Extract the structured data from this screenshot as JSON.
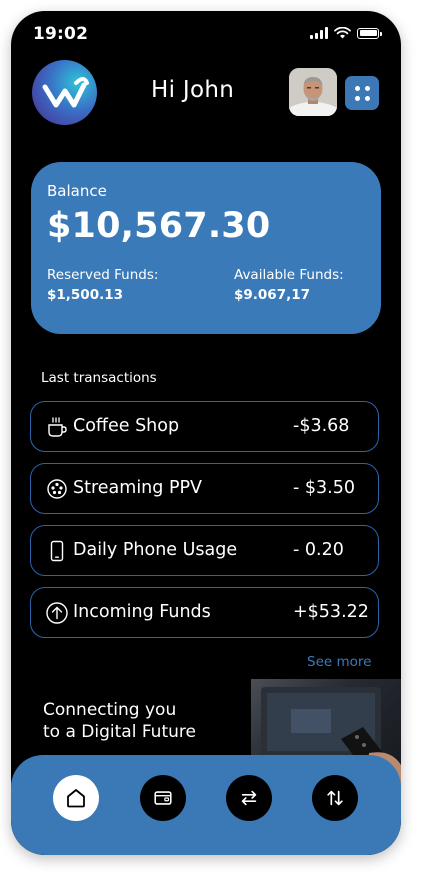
{
  "status_bar": {
    "time": "19:02"
  },
  "header": {
    "greeting": "Hi John"
  },
  "balance": {
    "label": "Balance",
    "amount": "$10,567.30",
    "reserved_label": "Reserved Funds:",
    "reserved_value": "$1,500.13",
    "available_label": "Available Funds:",
    "available_value": "$9.067,17"
  },
  "transactions": {
    "title": "Last transactions",
    "items": [
      {
        "name": "Coffee Shop",
        "amount": "-$3.68",
        "icon": "coffee-cup-icon"
      },
      {
        "name": "Streaming PPV",
        "amount": "- $3.50",
        "icon": "film-reel-icon"
      },
      {
        "name": "Daily Phone Usage",
        "amount": "- 0.20",
        "icon": "phone-icon"
      },
      {
        "name": "Incoming Funds",
        "amount": "+$53.22",
        "icon": "arrow-up-circle-icon"
      }
    ],
    "see_more": "See more"
  },
  "promo": {
    "line1": "Connecting you",
    "line2": "to a Digital Future"
  },
  "bottom_nav": {
    "items": [
      {
        "icon": "home-icon",
        "active": true
      },
      {
        "icon": "wallet-icon",
        "active": false
      },
      {
        "icon": "transfer-icon",
        "active": false
      },
      {
        "icon": "sort-arrows-icon",
        "active": false
      }
    ]
  },
  "colors": {
    "accent": "#3a7ab9",
    "background": "#000000",
    "border": "#2f63a8",
    "link": "#3d78b8"
  }
}
